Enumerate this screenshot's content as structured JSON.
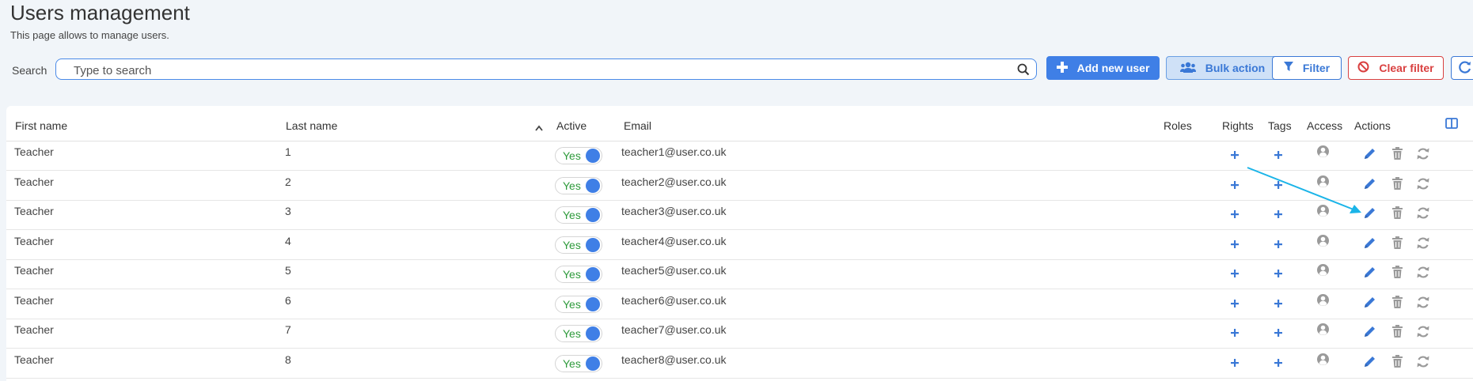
{
  "page": {
    "title": "Users management",
    "subtitle": "This page allows to manage users."
  },
  "search": {
    "label": "Search",
    "placeholder": "Type to search",
    "value": ""
  },
  "toolbar": {
    "add_new_user": "Add new user",
    "bulk_action": "Bulk action",
    "filter": "Filter",
    "clear_filter": "Clear filter"
  },
  "table": {
    "columns": {
      "first_name": "First name",
      "last_name": "Last name",
      "active": "Active",
      "email": "Email",
      "roles": "Roles",
      "rights": "Rights",
      "tags": "Tags",
      "access": "Access",
      "actions": "Actions"
    },
    "sort": {
      "column": "last_name",
      "direction": "ascending"
    },
    "rows": [
      {
        "first_name": "Teacher",
        "last_name": "1",
        "active": "Yes",
        "email": "teacher1@user.co.uk"
      },
      {
        "first_name": "Teacher",
        "last_name": "2",
        "active": "Yes",
        "email": "teacher2@user.co.uk"
      },
      {
        "first_name": "Teacher",
        "last_name": "3",
        "active": "Yes",
        "email": "teacher3@user.co.uk"
      },
      {
        "first_name": "Teacher",
        "last_name": "4",
        "active": "Yes",
        "email": "teacher4@user.co.uk"
      },
      {
        "first_name": "Teacher",
        "last_name": "5",
        "active": "Yes",
        "email": "teacher5@user.co.uk"
      },
      {
        "first_name": "Teacher",
        "last_name": "6",
        "active": "Yes",
        "email": "teacher6@user.co.uk"
      },
      {
        "first_name": "Teacher",
        "last_name": "7",
        "active": "Yes",
        "email": "teacher7@user.co.uk"
      },
      {
        "first_name": "Teacher",
        "last_name": "8",
        "active": "Yes",
        "email": "teacher8@user.co.uk"
      }
    ]
  },
  "icons": {
    "search": "search-icon",
    "add": "plus-icon",
    "bulk": "users-icon",
    "filter": "funnel-icon",
    "clear": "ban-icon",
    "refresh": "refresh-icon",
    "columns": "columns-icon",
    "access": "user-circle-icon",
    "edit": "pencil-icon",
    "delete": "trash-icon",
    "reset": "refresh-icon"
  },
  "colors": {
    "primary": "#3f7fe6",
    "danger": "#d94040",
    "success": "#2e9a3b",
    "annotation_arrow": "#1ab4e8"
  }
}
